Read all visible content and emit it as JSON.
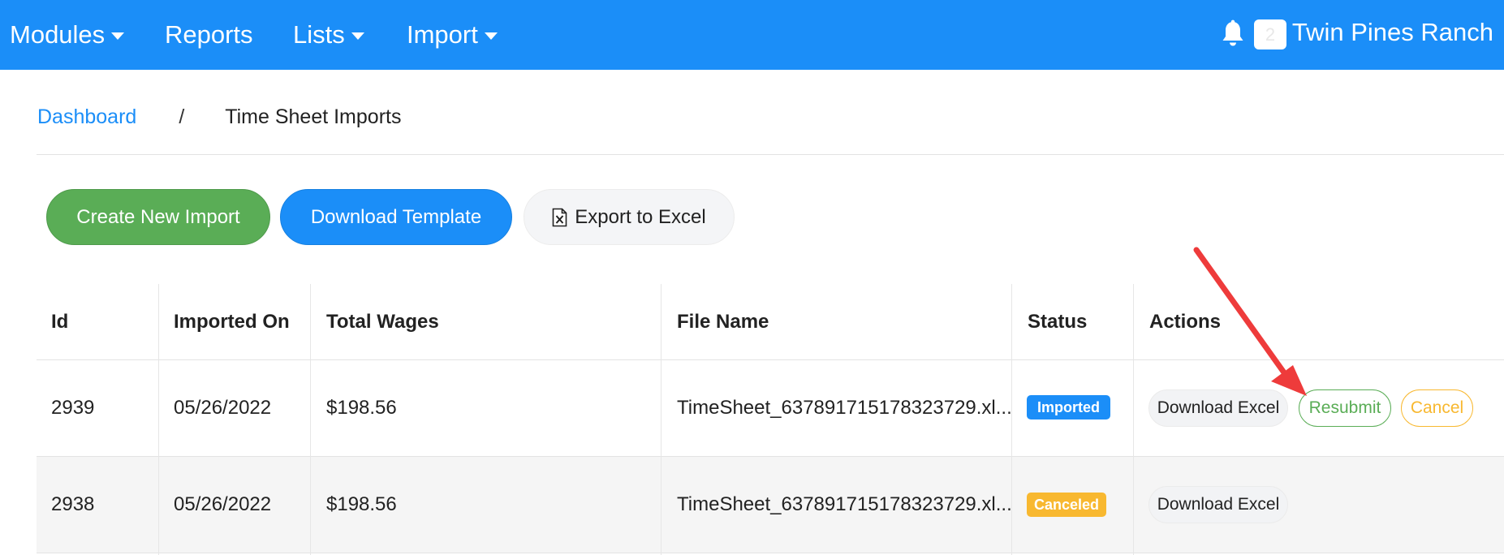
{
  "navbar": {
    "modules_label": "Modules",
    "reports_label": "Reports",
    "lists_label": "Lists",
    "import_label": "Import",
    "notification_count": "2",
    "org_name": "Twin Pines Ranch",
    "color": "#1b8ef8"
  },
  "breadcrumb": {
    "home": "Dashboard",
    "separator": "/",
    "current": "Time Sheet Imports"
  },
  "actions": {
    "create_label": "Create New Import",
    "template_label": "Download Template",
    "export_label": "Export to Excel",
    "export_icon": "excel-file-icon"
  },
  "table": {
    "columns": [
      "Id",
      "Imported On",
      "Total Wages",
      "File Name",
      "Status",
      "Actions"
    ],
    "rows": [
      {
        "id": "2939",
        "imported_on": "05/26/2022",
        "total_wages": "$198.56",
        "file_name": "TimeSheet_637891715178323729.xl...",
        "status": "Imported",
        "download_label": "Download Excel",
        "resubmit_label": "Resubmit",
        "cancel_label": "Cancel"
      },
      {
        "id": "2938",
        "imported_on": "05/26/2022",
        "total_wages": "$198.56",
        "file_name": "TimeSheet_637891715178323729.xl...",
        "status": "Canceled",
        "download_label": "Download Excel"
      }
    ]
  },
  "colors": {
    "primary": "#1b8ef8",
    "success": "#5aad56",
    "warning": "#f8b830",
    "annotation_arrow": "#ee3b3b"
  }
}
